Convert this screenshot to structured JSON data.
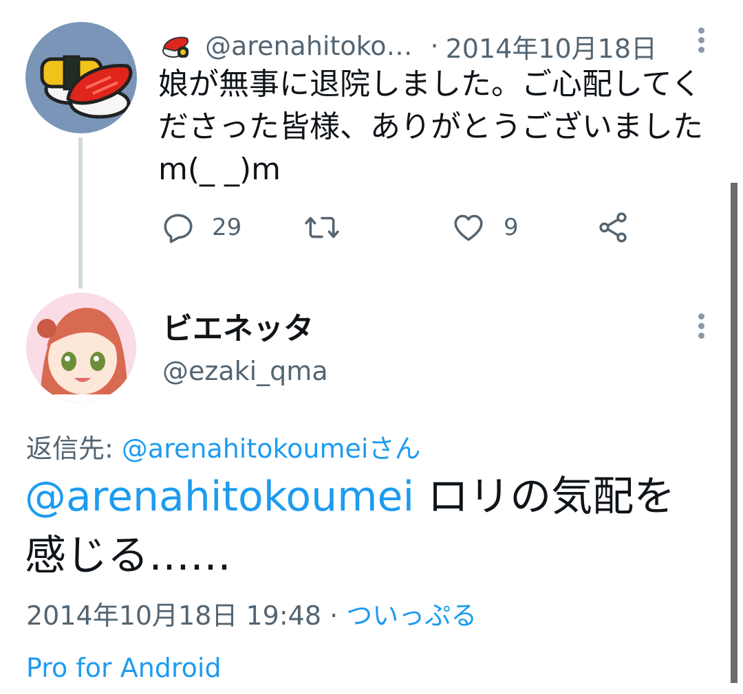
{
  "tweet1": {
    "handle": "@arenahitoko…",
    "separator": "·",
    "date": "2014年10月18日",
    "text": "娘が無事に退院しました。ご心配してくださった皆様、ありがとうございましたm(_ _)m",
    "reply_count": "29",
    "retweet_count": "",
    "like_count": "9",
    "icons": [
      "sushi-emoji-icon",
      "more-options-icon",
      "reply-icon",
      "retweet-icon",
      "like-icon",
      "share-icon"
    ]
  },
  "tweet2": {
    "display_name": "ビエネッタ",
    "handle": "@ezaki_qma",
    "reply_prefix": "返信先: ",
    "reply_handle": "@arenahitokoumeiさん",
    "mention": "@arenahitokoumei",
    "text": " ロリの気配を感じる……",
    "timestamp": "2014年10月18日 19:48",
    "separator": " · ",
    "client": "ついっぷる Pro for Android"
  },
  "colors": {
    "link": "#1d9bf0",
    "secondary_text": "#536471",
    "thread_line": "#cfd9de",
    "avatar1_bg": "#7a95b8"
  }
}
